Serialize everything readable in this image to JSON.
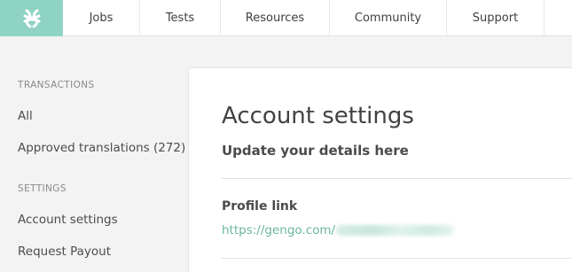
{
  "topnav": {
    "logo": "gengo-logo-icon",
    "items": [
      {
        "label": "Jobs"
      },
      {
        "label": "Tests"
      },
      {
        "label": "Resources"
      },
      {
        "label": "Community"
      },
      {
        "label": "Support"
      }
    ]
  },
  "sidebar": {
    "transactions_heading": "TRANSACTIONS",
    "transactions": [
      {
        "label": "All"
      },
      {
        "label": "Approved translations (272)"
      }
    ],
    "settings_heading": "SETTINGS",
    "settings": [
      {
        "label": "Account settings"
      },
      {
        "label": "Request Payout"
      }
    ]
  },
  "main": {
    "title": "Account settings",
    "subtitle": "Update your details here",
    "profile": {
      "label": "Profile link",
      "url_prefix": "https://gengo.com/"
    }
  },
  "colors": {
    "accent": "#8fd3c5",
    "link": "#6bb5a3"
  }
}
